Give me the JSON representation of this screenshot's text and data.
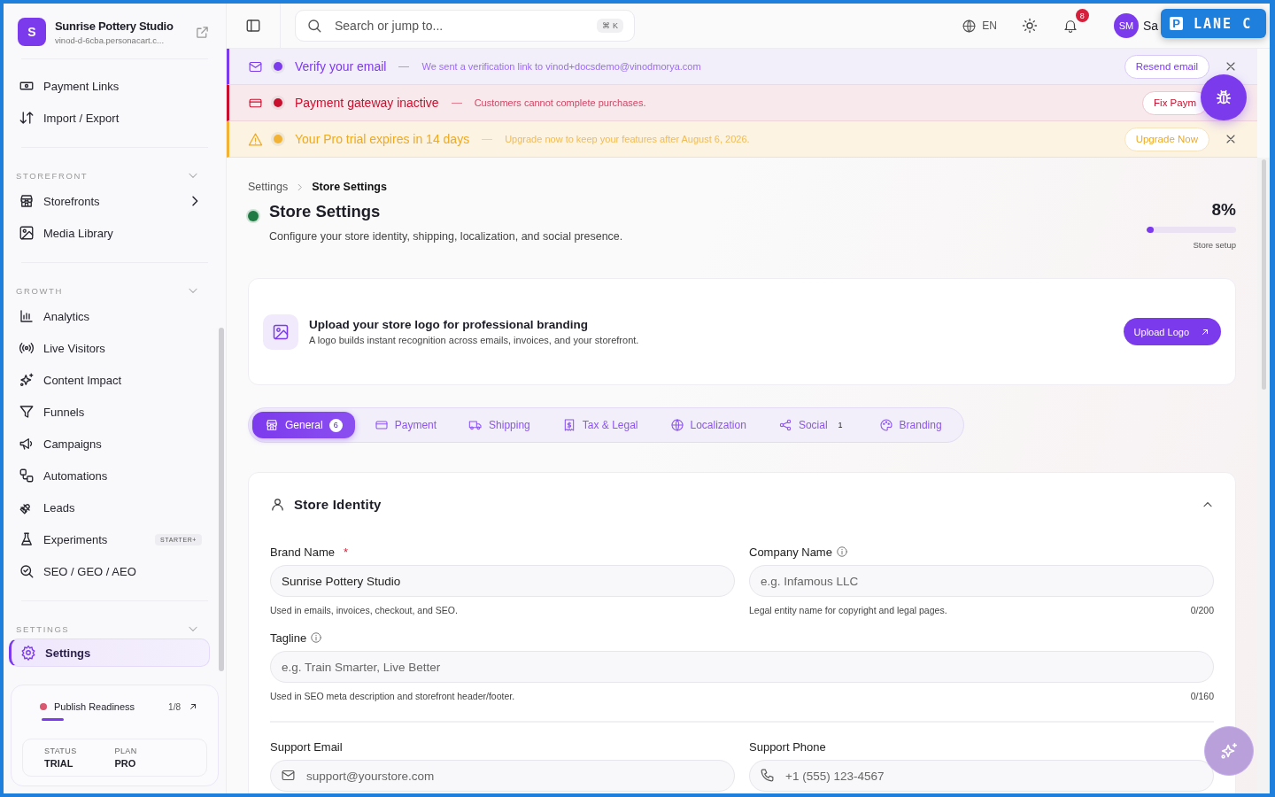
{
  "sidebar": {
    "brand": {
      "initial": "S",
      "name": "Sunrise Pottery Studio",
      "domain": "vinod-d-6cba.personacart.c..."
    },
    "groups": [
      {
        "items": [
          {
            "label": "Payment Links",
            "selected": false,
            "expandable": false
          },
          {
            "label": "Import / Export",
            "selected": false,
            "expandable": false
          }
        ]
      },
      {
        "title": "STOREFRONT",
        "items": [
          {
            "label": "Storefronts",
            "selected": false,
            "expandable": true
          },
          {
            "label": "Media Library",
            "selected": false,
            "expandable": false
          }
        ]
      },
      {
        "title": "GROWTH",
        "items": [
          {
            "label": "Analytics",
            "selected": false,
            "expandable": false
          },
          {
            "label": "Live Visitors",
            "selected": false,
            "expandable": false
          },
          {
            "label": "Content Impact",
            "selected": false,
            "expandable": false
          },
          {
            "label": "Funnels",
            "selected": false,
            "expandable": false
          },
          {
            "label": "Campaigns",
            "selected": false,
            "expandable": false
          },
          {
            "label": "Automations",
            "selected": false,
            "expandable": false
          },
          {
            "label": "Leads",
            "selected": false,
            "expandable": false
          },
          {
            "label": "Experiments",
            "selected": false,
            "expandable": false,
            "badge": "STARTER+"
          },
          {
            "label": "SEO / GEO / AEO",
            "selected": false,
            "expandable": false
          }
        ]
      },
      {
        "title": "SETTINGS",
        "items": [
          {
            "label": "Settings",
            "selected": true,
            "expandable": false
          }
        ]
      }
    ],
    "readiness": {
      "label": "Publish Readiness",
      "count": "1/8",
      "level": 0.125,
      "status_label": "STATUS",
      "status": "TRIAL",
      "plan_label": "PLAN",
      "plan": "PRO"
    }
  },
  "topbar": {
    "search": {
      "placeholder": "Search or jump to...",
      "shortcut": "⌘ K"
    },
    "language": "EN",
    "notifications": "8",
    "avatar": "SM",
    "user": "Sa"
  },
  "overlay_badge": {
    "letter": "P",
    "label": "LANE C"
  },
  "banners": [
    {
      "kind": "info",
      "title": "Verify your email",
      "message": "We sent a verification link to vinod+docsdemo@vinodmorya.com",
      "action": "Resend email",
      "dismissible": true
    },
    {
      "kind": "error",
      "title": "Payment gateway inactive",
      "message": "Customers cannot complete purchases.",
      "action": "Fix Paym",
      "dismissible": false
    },
    {
      "kind": "warning",
      "title": "Your Pro trial expires in 14 days",
      "message": "Upgrade now to keep your features after August 6, 2026.",
      "action": "Upgrade Now",
      "dismissible": true
    }
  ],
  "page": {
    "breadcrumb": [
      "Settings",
      "Store Settings"
    ],
    "title": "Store Settings",
    "description": "Configure your store identity, shipping, localization, and social presence.",
    "progress": {
      "value": "8%",
      "level": 0.08,
      "label": "Store setup"
    }
  },
  "logo_card": {
    "title": "Upload your store logo for professional branding",
    "text": "A logo builds instant recognition across emails, invoices, and your storefront.",
    "button": "Upload Logo"
  },
  "tabs": [
    {
      "label": "General",
      "count": "6",
      "selected": true
    },
    {
      "label": "Payment",
      "selected": false
    },
    {
      "label": "Shipping",
      "selected": false
    },
    {
      "label": "Tax & Legal",
      "selected": false
    },
    {
      "label": "Localization",
      "selected": false
    },
    {
      "label": "Social",
      "count": "1",
      "selected": false
    },
    {
      "label": "Branding",
      "selected": false
    }
  ],
  "section": {
    "title": "Store Identity",
    "expanded": true,
    "fields": [
      {
        "kind": "text",
        "label": "Brand Name",
        "marker": "*",
        "info": false,
        "wide": false,
        "value": "Sunrise Pottery Studio",
        "help": "Used in emails, invoices, checkout, and SEO."
      },
      {
        "kind": "text",
        "label": "Company Name",
        "info": true,
        "wide": false,
        "placeholder": "e.g. Infamous LLC",
        "help": "Legal entity name for copyright and legal pages.",
        "counter": "0/200"
      },
      {
        "kind": "text",
        "label": "Tagline",
        "info": true,
        "wide": true,
        "placeholder": "e.g. Train Smarter, Live Better",
        "help": "Used in SEO meta description and storefront header/footer.",
        "counter": "0/160"
      },
      {
        "kind": "divider"
      },
      {
        "kind": "email",
        "label": "Support Email",
        "info": false,
        "wide": false,
        "placeholder": "support@yourstore.com"
      },
      {
        "kind": "phone",
        "label": "Support Phone",
        "info": false,
        "wide": false,
        "placeholder": "+1 (555) 123-4567"
      }
    ]
  }
}
